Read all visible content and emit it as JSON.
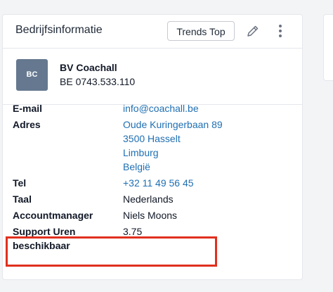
{
  "header": {
    "title": "Bedrijfsinformatie",
    "trends_button": "Trends Top",
    "edit_icon": "pencil-icon",
    "more_icon": "kebab-menu-icon"
  },
  "company": {
    "avatar_initials": "BC",
    "name": "BV Coachall",
    "vat": "BE 0743.533.110",
    "avatar_color": "#65788f"
  },
  "details": {
    "email_label": "E-mail",
    "email_value": "info@coachall.be",
    "address_label": "Adres",
    "address_lines": [
      "Oude Kuringerbaan 89",
      "3500 Hasselt",
      "Limburg",
      "België"
    ],
    "tel_label": "Tel",
    "tel_value": "+32 11 49 56 45",
    "language_label": "Taal",
    "language_value": "Nederlands",
    "manager_label": "Accountmanager",
    "manager_value": "Niels Moons",
    "support_label_line1": "Support Uren",
    "support_label_line2": "beschikbaar",
    "support_value": "3.75"
  },
  "colors": {
    "link": "#1f6fb2",
    "highlight": "#e0301e"
  }
}
